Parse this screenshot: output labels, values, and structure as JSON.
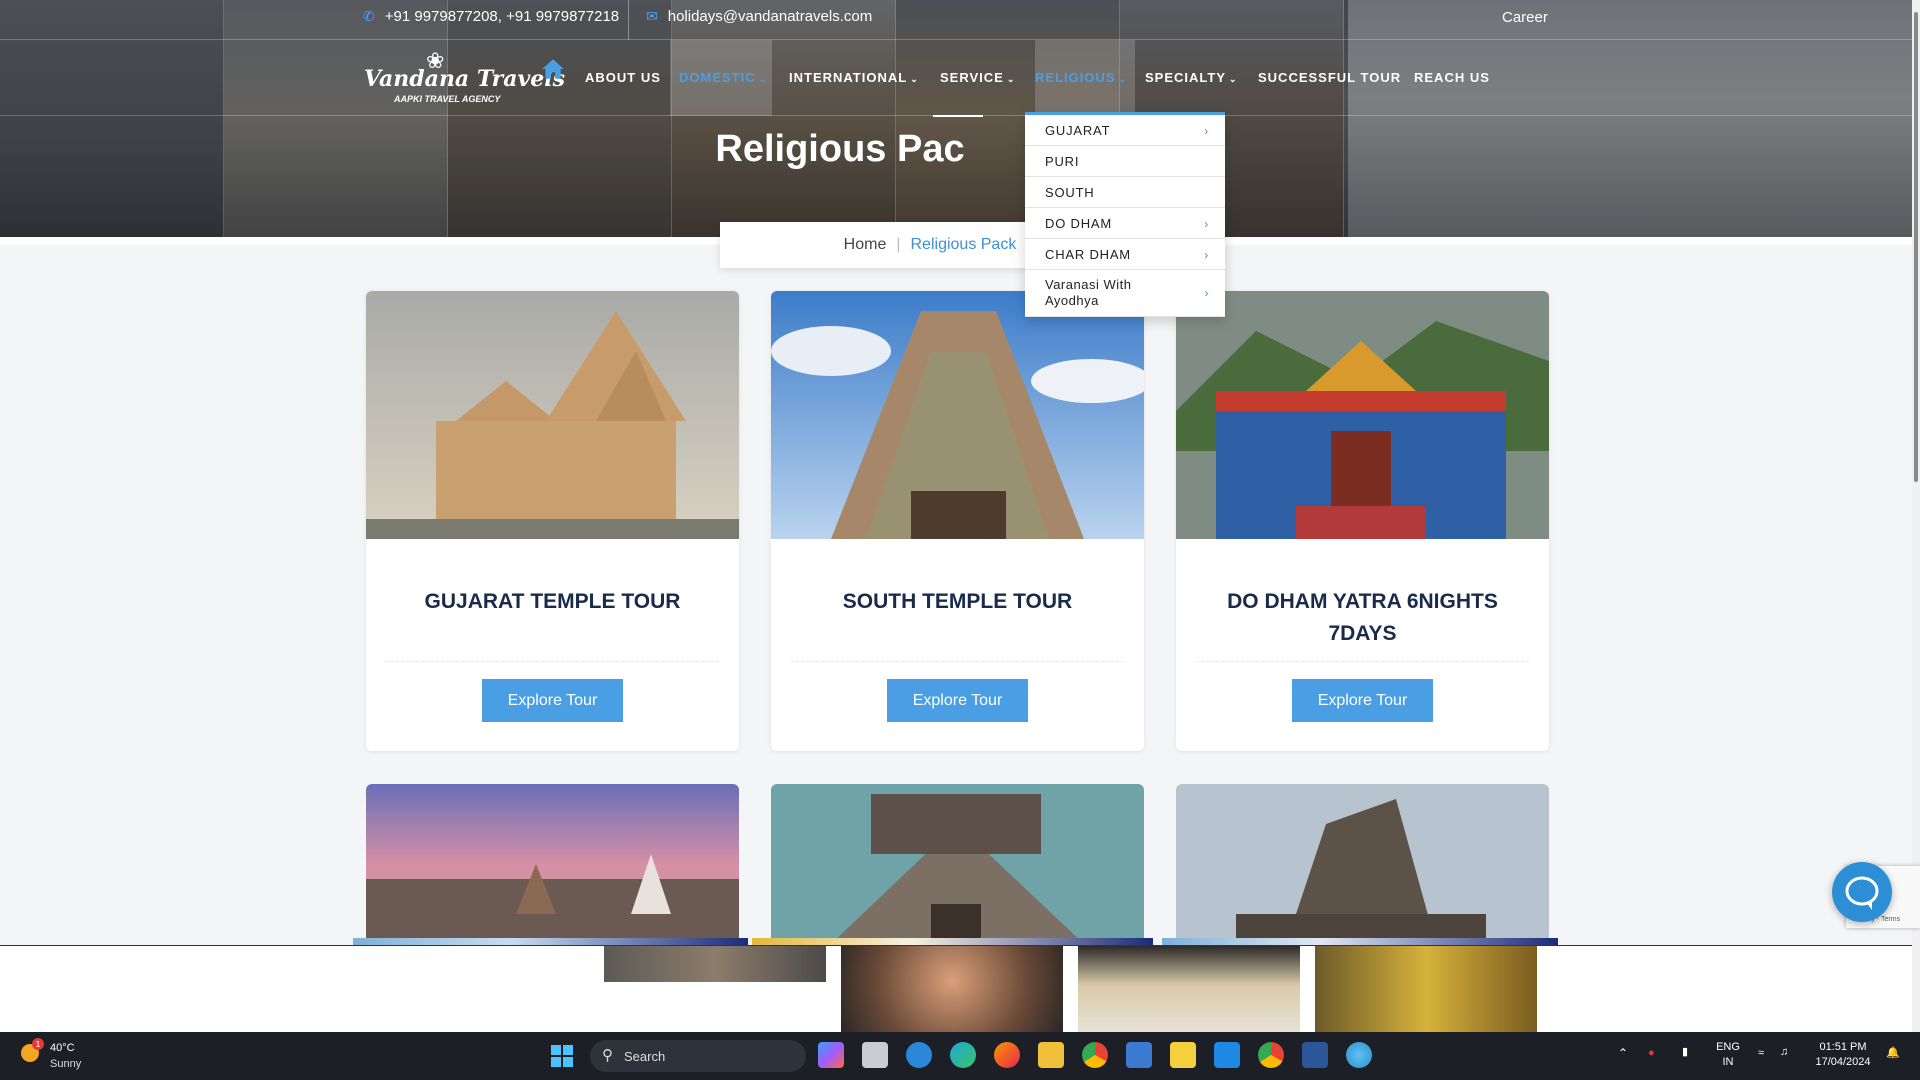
{
  "topbar": {
    "phone": "+91 9979877208, +91 9979877218",
    "email": "holidays@vandanatravels.com",
    "career": "Career"
  },
  "logo": {
    "name": "Vandana Travels",
    "tagline": "AAPKI TRAVEL AGENCY"
  },
  "nav": {
    "items": [
      {
        "label": "ABOUT US",
        "dropdown": false
      },
      {
        "label": "DOMESTIC",
        "dropdown": true,
        "active": true
      },
      {
        "label": "INTERNATIONAL",
        "dropdown": true
      },
      {
        "label": "SERVICE",
        "dropdown": true
      },
      {
        "label": "RELIGIOUS",
        "dropdown": true,
        "active": true
      },
      {
        "label": "SPECIALTY",
        "dropdown": true
      },
      {
        "label": "SUCCESSFUL TOUR",
        "dropdown": false
      },
      {
        "label": "REACH US",
        "dropdown": false
      }
    ],
    "caret": "⌄"
  },
  "page_title": "Religious Pac",
  "breadcrumb": {
    "home": "Home",
    "separator": "|",
    "current": "Religious Pack"
  },
  "dropdown": {
    "items": [
      {
        "label": "GUJARAT",
        "arrow": "›"
      },
      {
        "label": "PURI",
        "arrow": ""
      },
      {
        "label": "SOUTH",
        "arrow": ""
      },
      {
        "label": "DO DHAM",
        "arrow": "›"
      },
      {
        "label": "CHAR DHAM",
        "arrow": "›"
      },
      {
        "label": "Varanasi With Ayodhya",
        "arrow": "›"
      }
    ]
  },
  "cards": [
    {
      "title": "GUJARAT TEMPLE TOUR",
      "button": "Explore Tour"
    },
    {
      "title": "SOUTH TEMPLE TOUR",
      "button": "Explore Tour"
    },
    {
      "title": "DO DHAM YATRA 6NIGHTS 7DAYS",
      "button": "Explore Tour"
    }
  ],
  "recaptcha": {
    "text": "Privacy - Terms"
  },
  "taskbar": {
    "weather_temp": "40°C",
    "weather_condition": "Sunny",
    "weather_badge": "1",
    "search_label": "Search",
    "language": "ENG",
    "region": "IN",
    "time": "01:51 PM",
    "date": "17/04/2024"
  },
  "colors": {
    "accent": "#4a9ee3",
    "title_navy": "#1a2b4a",
    "taskbar": "#1c1f26"
  }
}
